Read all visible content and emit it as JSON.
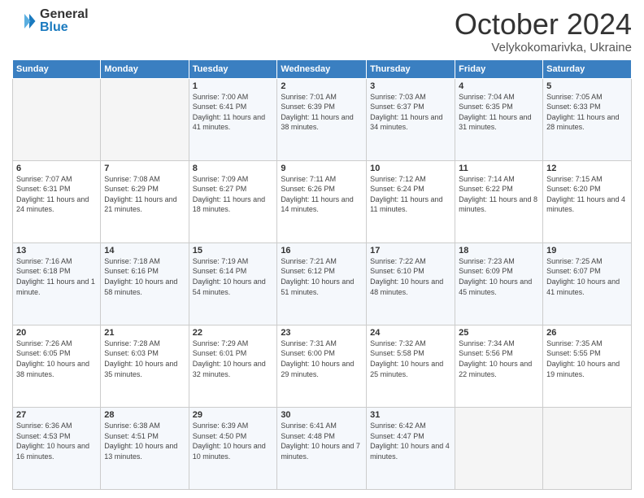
{
  "logo": {
    "general": "General",
    "blue": "Blue"
  },
  "title": "October 2024",
  "location": "Velykokomarivka, Ukraine",
  "weekdays": [
    "Sunday",
    "Monday",
    "Tuesday",
    "Wednesday",
    "Thursday",
    "Friday",
    "Saturday"
  ],
  "weeks": [
    [
      {
        "day": "",
        "info": ""
      },
      {
        "day": "",
        "info": ""
      },
      {
        "day": "1",
        "info": "Sunrise: 7:00 AM\nSunset: 6:41 PM\nDaylight: 11 hours and 41 minutes."
      },
      {
        "day": "2",
        "info": "Sunrise: 7:01 AM\nSunset: 6:39 PM\nDaylight: 11 hours and 38 minutes."
      },
      {
        "day": "3",
        "info": "Sunrise: 7:03 AM\nSunset: 6:37 PM\nDaylight: 11 hours and 34 minutes."
      },
      {
        "day": "4",
        "info": "Sunrise: 7:04 AM\nSunset: 6:35 PM\nDaylight: 11 hours and 31 minutes."
      },
      {
        "day": "5",
        "info": "Sunrise: 7:05 AM\nSunset: 6:33 PM\nDaylight: 11 hours and 28 minutes."
      }
    ],
    [
      {
        "day": "6",
        "info": "Sunrise: 7:07 AM\nSunset: 6:31 PM\nDaylight: 11 hours and 24 minutes."
      },
      {
        "day": "7",
        "info": "Sunrise: 7:08 AM\nSunset: 6:29 PM\nDaylight: 11 hours and 21 minutes."
      },
      {
        "day": "8",
        "info": "Sunrise: 7:09 AM\nSunset: 6:27 PM\nDaylight: 11 hours and 18 minutes."
      },
      {
        "day": "9",
        "info": "Sunrise: 7:11 AM\nSunset: 6:26 PM\nDaylight: 11 hours and 14 minutes."
      },
      {
        "day": "10",
        "info": "Sunrise: 7:12 AM\nSunset: 6:24 PM\nDaylight: 11 hours and 11 minutes."
      },
      {
        "day": "11",
        "info": "Sunrise: 7:14 AM\nSunset: 6:22 PM\nDaylight: 11 hours and 8 minutes."
      },
      {
        "day": "12",
        "info": "Sunrise: 7:15 AM\nSunset: 6:20 PM\nDaylight: 11 hours and 4 minutes."
      }
    ],
    [
      {
        "day": "13",
        "info": "Sunrise: 7:16 AM\nSunset: 6:18 PM\nDaylight: 11 hours and 1 minute."
      },
      {
        "day": "14",
        "info": "Sunrise: 7:18 AM\nSunset: 6:16 PM\nDaylight: 10 hours and 58 minutes."
      },
      {
        "day": "15",
        "info": "Sunrise: 7:19 AM\nSunset: 6:14 PM\nDaylight: 10 hours and 54 minutes."
      },
      {
        "day": "16",
        "info": "Sunrise: 7:21 AM\nSunset: 6:12 PM\nDaylight: 10 hours and 51 minutes."
      },
      {
        "day": "17",
        "info": "Sunrise: 7:22 AM\nSunset: 6:10 PM\nDaylight: 10 hours and 48 minutes."
      },
      {
        "day": "18",
        "info": "Sunrise: 7:23 AM\nSunset: 6:09 PM\nDaylight: 10 hours and 45 minutes."
      },
      {
        "day": "19",
        "info": "Sunrise: 7:25 AM\nSunset: 6:07 PM\nDaylight: 10 hours and 41 minutes."
      }
    ],
    [
      {
        "day": "20",
        "info": "Sunrise: 7:26 AM\nSunset: 6:05 PM\nDaylight: 10 hours and 38 minutes."
      },
      {
        "day": "21",
        "info": "Sunrise: 7:28 AM\nSunset: 6:03 PM\nDaylight: 10 hours and 35 minutes."
      },
      {
        "day": "22",
        "info": "Sunrise: 7:29 AM\nSunset: 6:01 PM\nDaylight: 10 hours and 32 minutes."
      },
      {
        "day": "23",
        "info": "Sunrise: 7:31 AM\nSunset: 6:00 PM\nDaylight: 10 hours and 29 minutes."
      },
      {
        "day": "24",
        "info": "Sunrise: 7:32 AM\nSunset: 5:58 PM\nDaylight: 10 hours and 25 minutes."
      },
      {
        "day": "25",
        "info": "Sunrise: 7:34 AM\nSunset: 5:56 PM\nDaylight: 10 hours and 22 minutes."
      },
      {
        "day": "26",
        "info": "Sunrise: 7:35 AM\nSunset: 5:55 PM\nDaylight: 10 hours and 19 minutes."
      }
    ],
    [
      {
        "day": "27",
        "info": "Sunrise: 6:36 AM\nSunset: 4:53 PM\nDaylight: 10 hours and 16 minutes."
      },
      {
        "day": "28",
        "info": "Sunrise: 6:38 AM\nSunset: 4:51 PM\nDaylight: 10 hours and 13 minutes."
      },
      {
        "day": "29",
        "info": "Sunrise: 6:39 AM\nSunset: 4:50 PM\nDaylight: 10 hours and 10 minutes."
      },
      {
        "day": "30",
        "info": "Sunrise: 6:41 AM\nSunset: 4:48 PM\nDaylight: 10 hours and 7 minutes."
      },
      {
        "day": "31",
        "info": "Sunrise: 6:42 AM\nSunset: 4:47 PM\nDaylight: 10 hours and 4 minutes."
      },
      {
        "day": "",
        "info": ""
      },
      {
        "day": "",
        "info": ""
      }
    ]
  ]
}
